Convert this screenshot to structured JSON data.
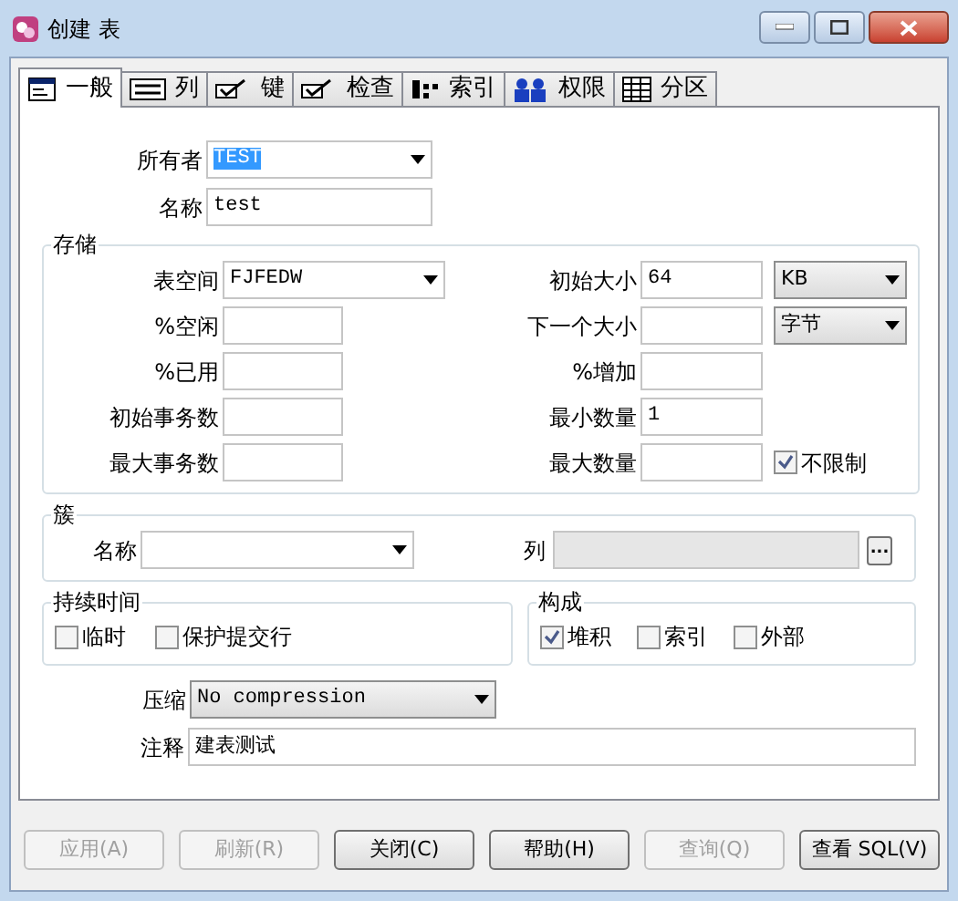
{
  "window": {
    "title": "创建 表"
  },
  "tabs": [
    {
      "label": "一般",
      "selected": true
    },
    {
      "label": "列",
      "selected": false
    },
    {
      "label": "键",
      "selected": false
    },
    {
      "label": "检查",
      "selected": false
    },
    {
      "label": "索引",
      "selected": false
    },
    {
      "label": "权限",
      "selected": false
    },
    {
      "label": "分区",
      "selected": false
    }
  ],
  "general": {
    "owner": {
      "label": "所有者",
      "value": "TEST"
    },
    "name": {
      "label": "名称",
      "value": "test"
    }
  },
  "storage": {
    "title": "存储",
    "left": [
      {
        "label": "表空间",
        "kind": "dropdown",
        "value": "FJFEDW"
      },
      {
        "label": "%空闲",
        "kind": "field"
      },
      {
        "label": "%已用",
        "kind": "field"
      },
      {
        "label": "初始事务数",
        "kind": "field"
      },
      {
        "label": "最大事务数",
        "kind": "field"
      }
    ],
    "right": [
      {
        "label": "初始大小",
        "value": "64",
        "unit": "KB"
      },
      {
        "label": "下一个大小",
        "unit": "字节"
      },
      {
        "label": "%增加"
      },
      {
        "label": "最小数量",
        "value": "1"
      },
      {
        "label": "最大数量",
        "option": {
          "label": "不限制",
          "checked": true
        }
      }
    ]
  },
  "cluster": {
    "title": "簇",
    "name_label": "名称",
    "column_label": "列",
    "browse": "..."
  },
  "duration": {
    "title": "持续时间",
    "options": [
      {
        "label": "临时",
        "checked": false
      },
      {
        "label": "保护提交行",
        "checked": false
      }
    ]
  },
  "composition": {
    "title": "构成",
    "options": [
      {
        "label": "堆积",
        "checked": true
      },
      {
        "label": "索引",
        "checked": false
      },
      {
        "label": "外部",
        "checked": false
      }
    ]
  },
  "compression": {
    "label": "压缩",
    "value": "No compression"
  },
  "comment": {
    "label": "注释",
    "value": "建表测试"
  },
  "buttons": [
    {
      "label": "应用(A)",
      "disabled": true
    },
    {
      "label": "刷新(R)",
      "disabled": true
    },
    {
      "label": "关闭(C)",
      "disabled": false
    },
    {
      "label": "帮助(H)",
      "disabled": false
    },
    {
      "label": "查询(Q)",
      "disabled": true
    },
    {
      "label": "查看 SQL(V)",
      "disabled": false
    }
  ]
}
